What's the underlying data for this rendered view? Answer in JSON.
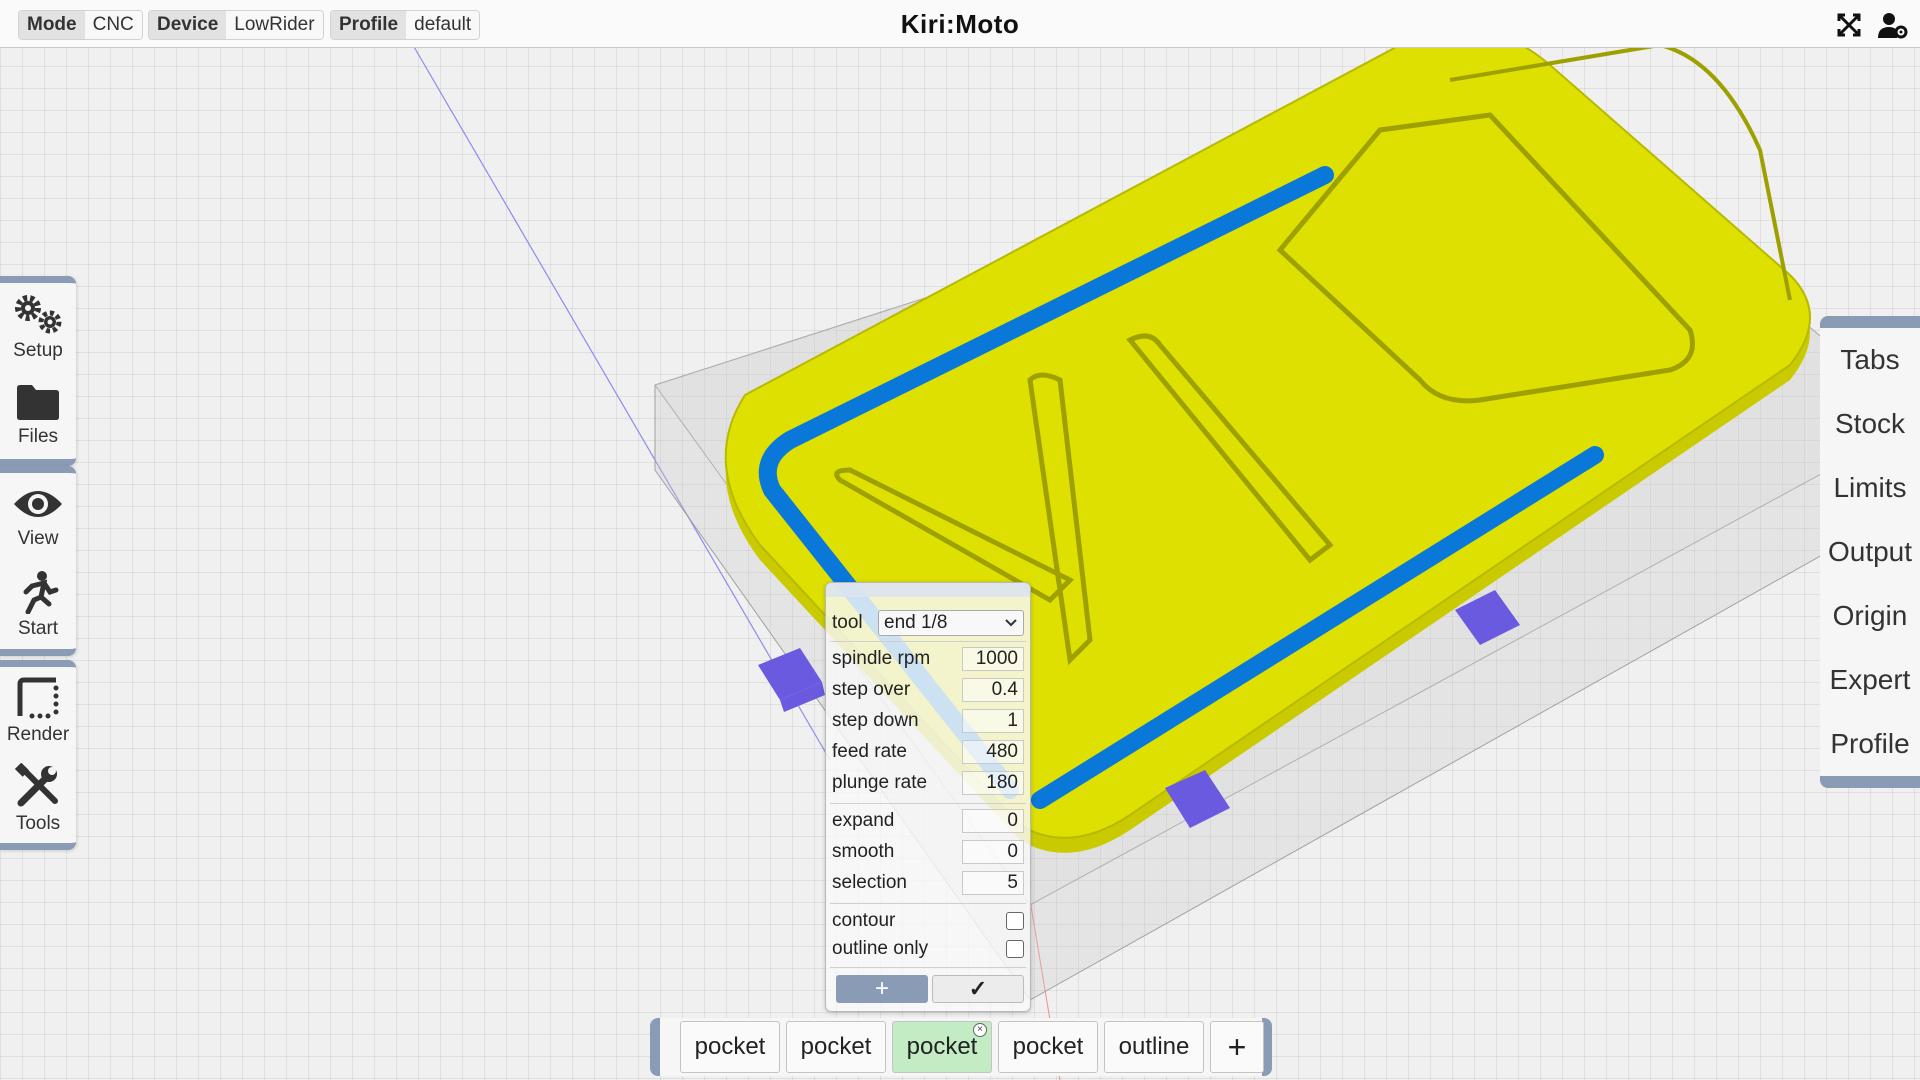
{
  "topbar": {
    "mode_key": "Mode",
    "mode_value": "CNC",
    "device_key": "Device",
    "device_value": "LowRider",
    "profile_key": "Profile",
    "profile_value": "default",
    "title": "Kiri:Moto",
    "icons": [
      "fullscreen-icon",
      "user-settings-icon"
    ]
  },
  "left_toolbar": [
    {
      "label": "Setup",
      "icon": "gears-icon"
    },
    {
      "label": "Files",
      "icon": "folder-icon"
    },
    {
      "label": "View",
      "icon": "eye-icon"
    },
    {
      "label": "Start",
      "icon": "running-person-icon"
    },
    {
      "label": "Render",
      "icon": "render-frame-icon"
    },
    {
      "label": "Tools",
      "icon": "tools-icon"
    }
  ],
  "right_tabs": [
    "Tabs",
    "Stock",
    "Limits",
    "Output",
    "Origin",
    "Expert",
    "Profile"
  ],
  "op_dialog": {
    "tool_label": "tool",
    "tool_value": "end 1/8",
    "fields": [
      {
        "label": "spindle rpm",
        "value": "1000"
      },
      {
        "label": "step over",
        "value": "0.4"
      },
      {
        "label": "step down",
        "value": "1"
      },
      {
        "label": "feed rate",
        "value": "480"
      },
      {
        "label": "plunge rate",
        "value": "180"
      }
    ],
    "fields2": [
      {
        "label": "expand",
        "value": "0"
      },
      {
        "label": "smooth",
        "value": "0"
      },
      {
        "label": "selection",
        "value": "5"
      }
    ],
    "checks": [
      {
        "label": "contour",
        "checked": false
      },
      {
        "label": "outline only",
        "checked": false
      }
    ],
    "add_symbol": "+",
    "ok_symbol": "✓"
  },
  "operations": [
    {
      "label": "pocket",
      "active": false
    },
    {
      "label": "pocket",
      "active": false
    },
    {
      "label": "pocket",
      "active": true
    },
    {
      "label": "pocket",
      "active": false
    },
    {
      "label": "outline",
      "active": false
    }
  ],
  "operations_add": "+",
  "colors": {
    "part": "#dde000",
    "toolpath": "#0a78d8",
    "tabs": "#6a5ae0",
    "accent": "#8a9bb5",
    "active_op": "#c4ecc4"
  }
}
